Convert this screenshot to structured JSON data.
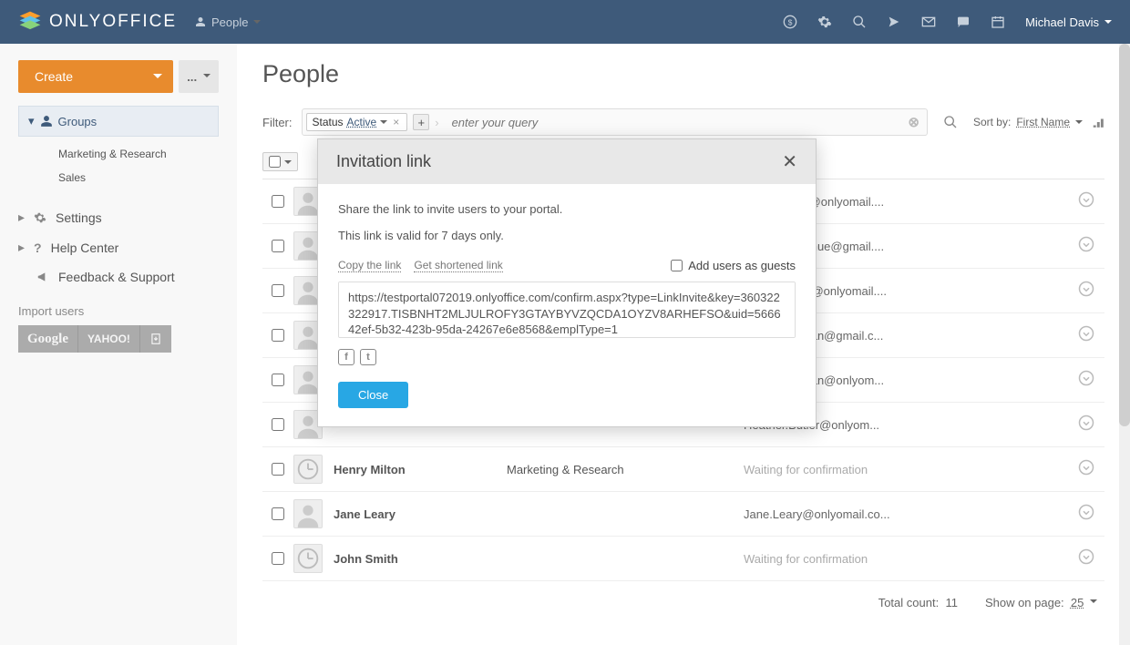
{
  "brand": {
    "name": "ONLYOFFICE"
  },
  "module": {
    "label": "People"
  },
  "user": {
    "name": "Michael Davis"
  },
  "sidebar": {
    "create_label": "Create",
    "other_label": "...",
    "groups_label": "Groups",
    "groups": [
      "Marketing & Research",
      "Sales"
    ],
    "menu": {
      "settings": "Settings",
      "help": "Help Center",
      "feedback": "Feedback & Support"
    },
    "import_label": "Import users",
    "import_buttons": {
      "google": "Google",
      "yahoo": "YAHOO!",
      "file": "file"
    }
  },
  "page": {
    "title": "People",
    "filter_label": "Filter:",
    "filter_status_label": "Status",
    "filter_status_value": "Active",
    "filter_query_placeholder": "enter your query",
    "sort_label": "Sort by:",
    "sort_value": "First Name",
    "total_label": "Total count:",
    "total_value": "11",
    "show_per_page_label": "Show on page:",
    "show_per_page_value": "25"
  },
  "people": [
    {
      "name": "",
      "dept": "",
      "email": "anna.suarez@onlyomail....",
      "pending": false
    },
    {
      "name": "",
      "dept": "",
      "email": "cynthia.donohue@gmail....",
      "pending": false
    },
    {
      "name": "",
      "dept": "",
      "email": "david.connor@onlyomail....",
      "pending": false
    },
    {
      "name": "",
      "dept": "",
      "email": "elizabeth.rayan@gmail.c...",
      "pending": false
    },
    {
      "name": "",
      "dept": "",
      "email": "elizabeth.rayan@onlyom...",
      "pending": false
    },
    {
      "name": "",
      "dept": "",
      "email": "Heather.Butler@onlyom...",
      "pending": false
    },
    {
      "name": "Henry Milton",
      "dept": "Marketing & Research",
      "email": "Waiting for confirmation",
      "pending": true
    },
    {
      "name": "Jane Leary",
      "dept": "",
      "email": "Jane.Leary@onlyomail.co...",
      "pending": false
    },
    {
      "name": "John Smith",
      "dept": "",
      "email": "Waiting for confirmation",
      "pending": true
    }
  ],
  "modal": {
    "title": "Invitation link",
    "intro": "Share the link to invite users to your portal.",
    "valid": "This link is valid for 7 days only.",
    "copy_label": "Copy the link",
    "shorten_label": "Get shortened link",
    "guests_label": "Add users as guests",
    "link": "https://testportal072019.onlyoffice.com/confirm.aspx?type=LinkInvite&key=360322322917.TISBNHT2MLJULROFY3GTAYBYVZQCDA1OYZV8ARHEFSO&uid=566642ef-5b32-423b-95da-24267e6e8568&emplType=1",
    "close_label": "Close"
  }
}
